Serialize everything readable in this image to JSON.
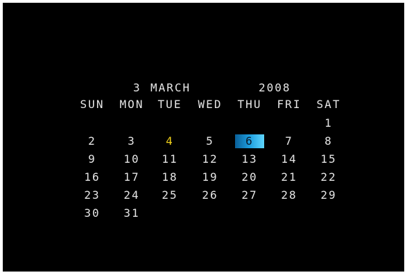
{
  "header": {
    "day": "3",
    "month": "MARCH",
    "year": "2008"
  },
  "weekdays": [
    "SUN",
    "MON",
    "TUE",
    "WED",
    "THU",
    "FRI",
    "SAT"
  ],
  "weeks": [
    [
      "",
      "",
      "",
      "",
      "",
      "",
      "1"
    ],
    [
      "2",
      "3",
      "4",
      "5",
      "6",
      "7",
      "8"
    ],
    [
      "9",
      "10",
      "11",
      "12",
      "13",
      "14",
      "15"
    ],
    [
      "16",
      "17",
      "18",
      "19",
      "20",
      "21",
      "22"
    ],
    [
      "23",
      "24",
      "25",
      "26",
      "27",
      "28",
      "29"
    ],
    [
      "30",
      "31",
      "",
      "",
      "",
      "",
      ""
    ]
  ],
  "highlight": {
    "today": "4",
    "selected": "6"
  },
  "colors": {
    "background": "#000000",
    "text": "#e6e6e6",
    "today": "#f2d21a",
    "selected_bg": "#1d9fe0"
  }
}
